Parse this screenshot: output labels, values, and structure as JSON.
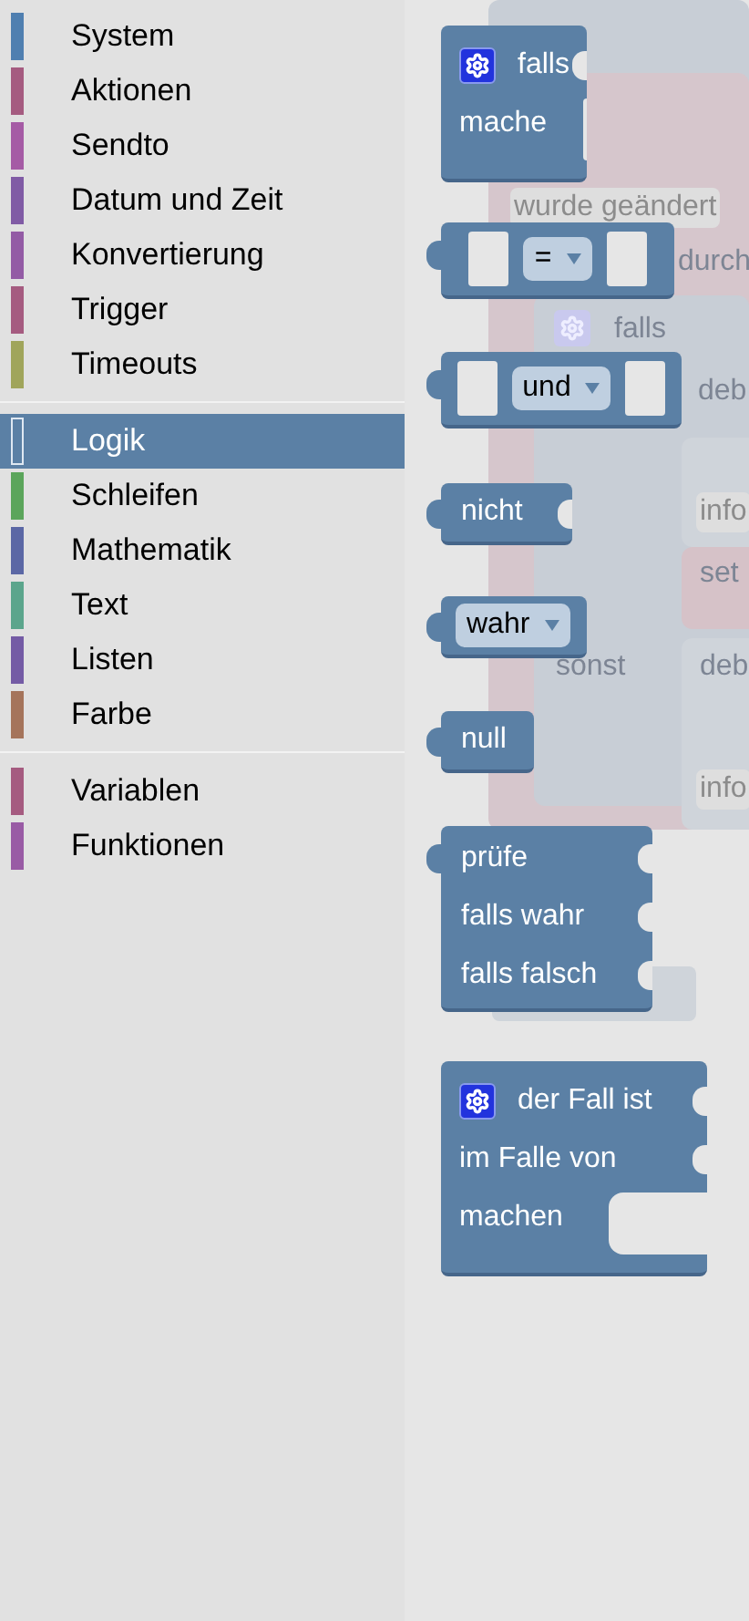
{
  "categories": [
    [
      {
        "label": "System",
        "color": "#4f7fb0",
        "selected": false
      },
      {
        "label": "Aktionen",
        "color": "#a55b80",
        "selected": false
      },
      {
        "label": "Sendto",
        "color": "#a55ba5",
        "selected": false
      },
      {
        "label": "Datum und Zeit",
        "color": "#805ba5",
        "selected": false
      },
      {
        "label": "Konvertierung",
        "color": "#935ba5",
        "selected": false
      },
      {
        "label": "Trigger",
        "color": "#a55b80",
        "selected": false
      },
      {
        "label": "Timeouts",
        "color": "#a0a55b",
        "selected": false
      }
    ],
    [
      {
        "label": "Logik",
        "color": "#5b80a5",
        "selected": true
      },
      {
        "label": "Schleifen",
        "color": "#5ba55b",
        "selected": false
      },
      {
        "label": "Mathematik",
        "color": "#5b67a5",
        "selected": false
      },
      {
        "label": "Text",
        "color": "#5ba58c",
        "selected": false
      },
      {
        "label": "Listen",
        "color": "#745ba5",
        "selected": false
      },
      {
        "label": "Farbe",
        "color": "#a5745b",
        "selected": false
      }
    ],
    [
      {
        "label": "Variablen",
        "color": "#a55b80",
        "selected": false
      },
      {
        "label": "Funktionen",
        "color": "#995ba5",
        "selected": false
      }
    ]
  ],
  "workspace_texts": [
    {
      "kind": "field",
      "text": "wurde geändert"
    },
    {
      "kind": "label",
      "text": "durch"
    },
    {
      "kind": "label",
      "text": "falls"
    },
    {
      "kind": "label",
      "text": "deb"
    },
    {
      "kind": "field",
      "text": "info"
    },
    {
      "kind": "label",
      "text": "set"
    },
    {
      "kind": "label",
      "text": "sonst"
    },
    {
      "kind": "label",
      "text": "deb"
    },
    {
      "kind": "field",
      "text": "info"
    }
  ],
  "blocks": [
    {
      "kind": "statement",
      "gear": true,
      "lines": [
        "falls",
        "mache"
      ]
    },
    {
      "kind": "binary",
      "dropdown": "="
    },
    {
      "kind": "binary",
      "dropdown": "und"
    },
    {
      "kind": "value",
      "label": "nicht",
      "input": true
    },
    {
      "kind": "value",
      "dropdown": "wahr"
    },
    {
      "kind": "value",
      "label": "null"
    },
    {
      "kind": "multi",
      "lines": [
        "prüfe",
        "falls wahr",
        "falls falsch"
      ]
    },
    {
      "kind": "statement",
      "gear": true,
      "lines": [
        "der Fall ist",
        "im Falle von",
        "machen"
      ]
    }
  ]
}
